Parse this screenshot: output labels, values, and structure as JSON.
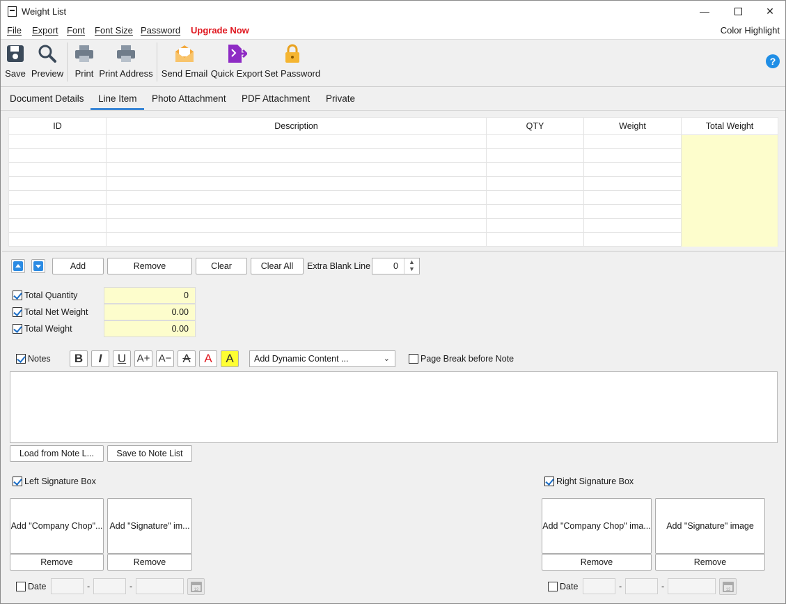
{
  "window": {
    "title": "Weight List",
    "min_glyph": "—",
    "max_glyph": "☐",
    "close_glyph": "✕"
  },
  "menu": {
    "file": "File",
    "export": "Export",
    "font": "Font",
    "font_size": "Font Size",
    "password": "Password",
    "upgrade": "Upgrade Now",
    "color_highlight": "Color Highlight"
  },
  "toolbar": {
    "save": "Save",
    "preview": "Preview",
    "print": "Print",
    "print_address": "Print Address",
    "send_email": "Send Email",
    "quick_export": "Quick Export",
    "set_password": "Set Password",
    "help": "?"
  },
  "tabs": [
    "Document Details",
    "Line Item",
    "Photo Attachment",
    "PDF Attachment",
    "Private"
  ],
  "table": {
    "headers": [
      "ID",
      "Description",
      "QTY",
      "Weight",
      "Total Weight"
    ]
  },
  "row_actions": {
    "add": "Add",
    "remove": "Remove",
    "clear": "Clear",
    "clear_all": "Clear All",
    "extra_blank_line_label": "Extra Blank Line",
    "extra_blank_line_value": "0"
  },
  "totals": {
    "total_quantity_label": "Total Quantity",
    "total_quantity_value": "0",
    "total_net_weight_label": "Total Net Weight",
    "total_net_weight_value": "0.00",
    "total_weight_label": "Total Weight",
    "total_weight_value": "0.00"
  },
  "notes": {
    "label": "Notes",
    "dynamic_content": "Add Dynamic Content ...",
    "page_break": "Page Break before Note",
    "load_list": "Load from Note L...",
    "save_list": "Save to Note List",
    "fmt": {
      "bold": "B",
      "italic": "I",
      "underline": "U",
      "grow": "A+",
      "shrink": "A−",
      "strike": "A",
      "color": "A",
      "highlight": "A"
    }
  },
  "left_sig": {
    "label": "Left Signature Box",
    "company_chop": "Add \"Company Chop\"...",
    "signature": "Add \"Signature\" im...",
    "remove1": "Remove",
    "remove2": "Remove",
    "date": "Date",
    "dash": "-"
  },
  "right_sig": {
    "label": "Right Signature Box",
    "company_chop": "Add \"Company Chop\" ima...",
    "signature": "Add \"Signature\" image",
    "remove1": "Remove",
    "remove2": "Remove",
    "date": "Date",
    "dash": "-"
  },
  "colors": {
    "accent": "#2b8be3",
    "upgrade": "#e0171f",
    "highlight_cell": "#fdfdcc"
  }
}
